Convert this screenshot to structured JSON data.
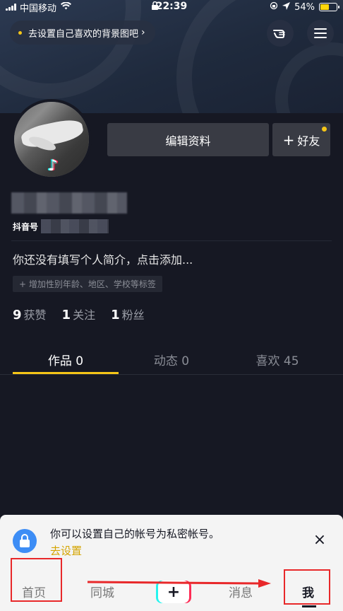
{
  "status_bar": {
    "carrier": "中国移动",
    "time": "22:39",
    "battery": "54%",
    "battery_level": 0.54
  },
  "header": {
    "bg_tip": "去设置自己喜欢的背景图吧",
    "bg_tip_chevron": "›",
    "icons": [
      "hand-pointer-icon",
      "menu-icon"
    ]
  },
  "profile": {
    "edit_label": "编辑资料",
    "add_friend_label": "好友",
    "id_prefix": "抖音号",
    "bio_placeholder": "你还没有填写个人简介，点击添加...",
    "tag_hint": "+ 增加性别年龄、地区、学校等标签",
    "stats": [
      {
        "value": "9",
        "label": "获赞"
      },
      {
        "value": "1",
        "label": "关注"
      },
      {
        "value": "1",
        "label": "粉丝"
      }
    ]
  },
  "tabs": [
    {
      "label": "作品 0",
      "active": true
    },
    {
      "label": "动态 0",
      "active": false
    },
    {
      "label": "喜欢 45",
      "active": false
    }
  ],
  "privacy_banner": {
    "text": "你可以设置自己的帐号为私密帐号。",
    "link": "去设置",
    "close": "×"
  },
  "bottom_nav": {
    "home": "首页",
    "city": "同城",
    "add": "+",
    "messages": "消息",
    "me": "我"
  },
  "colors": {
    "accent": "#f5c518",
    "background": "#161823",
    "annotation": "#e8282a"
  }
}
